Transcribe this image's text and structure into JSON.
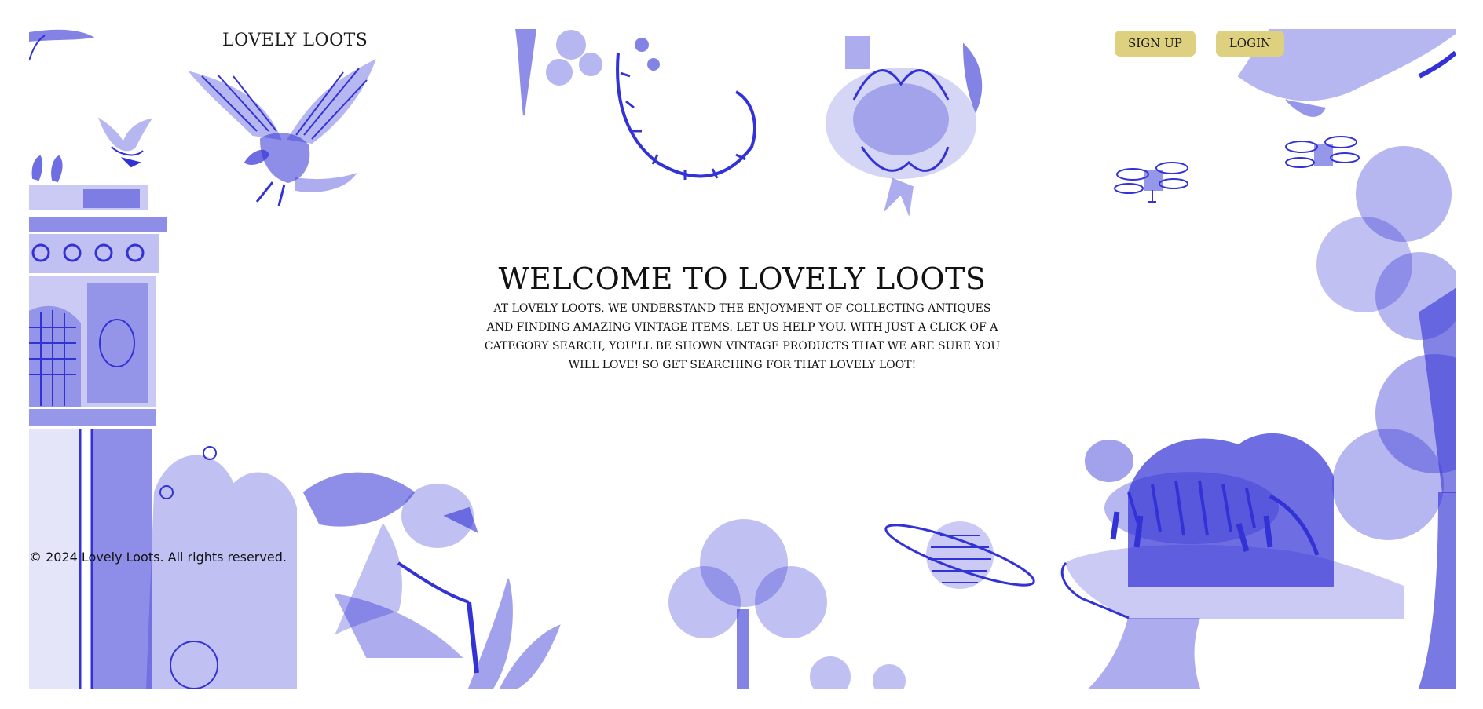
{
  "header": {
    "logo": "LOVELY LOOTS",
    "signup_label": "SIGN UP",
    "login_label": "LOGIN"
  },
  "hero": {
    "title": "WELCOME TO LOVELY LOOTS",
    "body": "AT LOVELY LOOTS, WE UNDERSTAND THE ENJOYMENT OF COLLECTING ANTIQUES AND FINDING AMAZING VINTAGE ITEMS. LET US HELP YOU. WITH JUST A CLICK OF A CATEGORY SEARCH, YOU'LL BE SHOWN VINTAGE PRODUCTS THAT WE ARE SURE YOU WILL LOVE! SO GET SEARCHING FOR THAT LOVELY LOOT!"
  },
  "footer": {
    "copyright": "© 2024 Lovely Loots. All rights reserved."
  },
  "theme": {
    "illustration_color": "#3232d6",
    "button_color": "#ddd07e",
    "text_color": "#111111"
  },
  "illustration": {
    "elements": [
      "eagle-icon",
      "dove-icon",
      "pigeons-icon",
      "arch-icon",
      "vine-icon",
      "peony-icon",
      "drone-icon",
      "tree-icon",
      "tiger-icon",
      "planet-icon",
      "cyclist-icon",
      "shrub-icon"
    ]
  }
}
